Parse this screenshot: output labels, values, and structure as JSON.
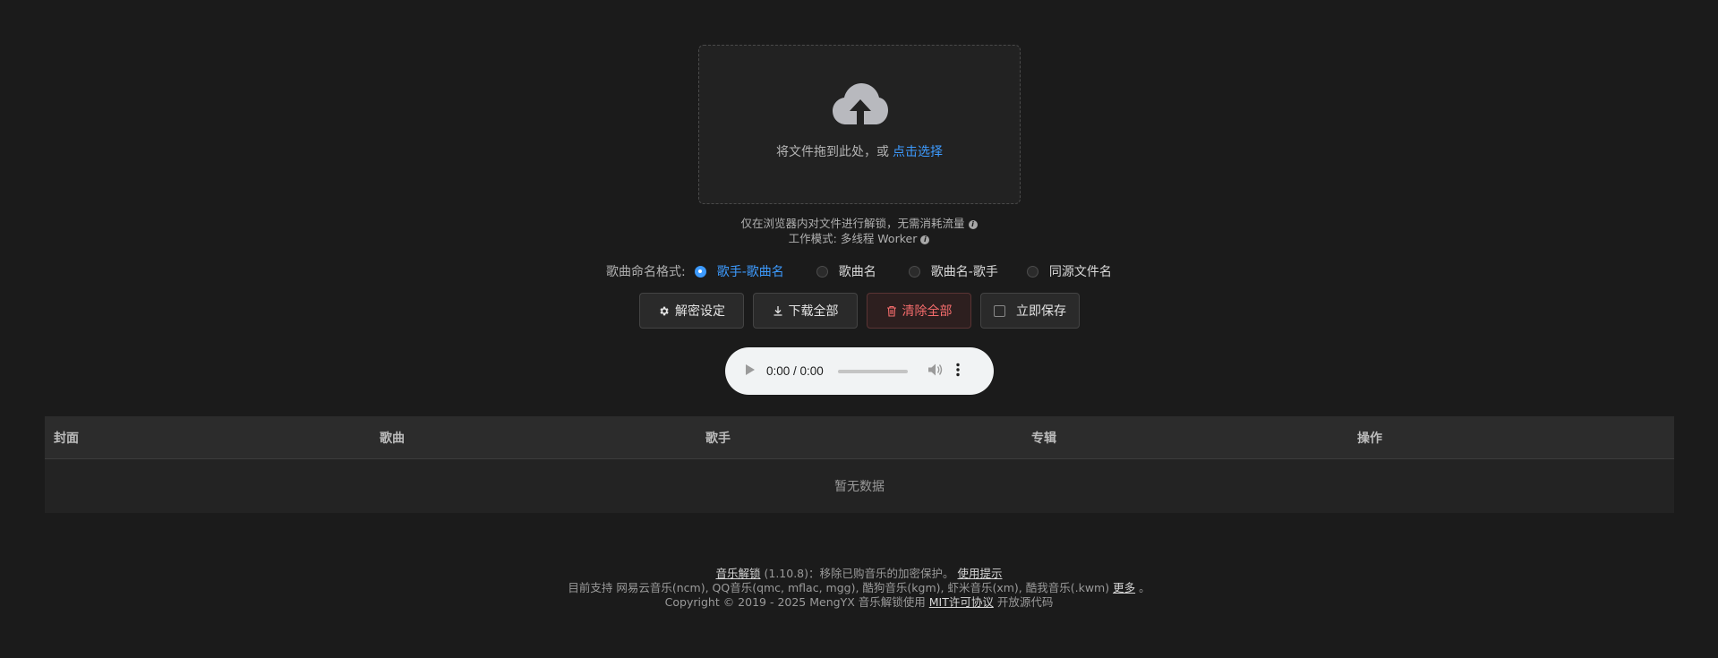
{
  "upload": {
    "prompt": "将文件拖到此处，或",
    "link": "点击选择"
  },
  "info": {
    "line1": "仅在浏览器内对文件进行解锁，无需消耗流量",
    "line2": "工作模式: 多线程 Worker"
  },
  "naming": {
    "label": "歌曲命名格式:",
    "options": [
      "歌手-歌曲名",
      "歌曲名",
      "歌曲名-歌手",
      "同源文件名"
    ],
    "selected": "歌手-歌曲名"
  },
  "buttons": {
    "settings": "解密设定",
    "download_all": "下载全部",
    "clear_all": "清除全部",
    "save_now": "立即保存"
  },
  "audio": {
    "time": "0:00 / 0:00"
  },
  "table": {
    "headers": [
      "封面",
      "歌曲",
      "歌手",
      "专辑",
      "操作"
    ],
    "empty": "暂无数据"
  },
  "footer": {
    "app_name": "音乐解锁",
    "version": "(1.10.8)：移除已购音乐的加密保护。",
    "usage_link": "使用提示",
    "support_text": "目前支持 网易云音乐(ncm), QQ音乐(qmc, mflac, mgg), 酷狗音乐(kgm), 虾米音乐(xm), 酷我音乐(.kwm)",
    "more_link": "更多",
    "period": "。",
    "copyright": "Copyright © 2019 - 2025 MengYX 音乐解锁使用",
    "license_link": "MIT许可协议",
    "open_source": "开放源代码"
  },
  "colors": {
    "accent": "#3d9bff",
    "danger": "#f56c6c",
    "background": "#1b1b1b"
  }
}
